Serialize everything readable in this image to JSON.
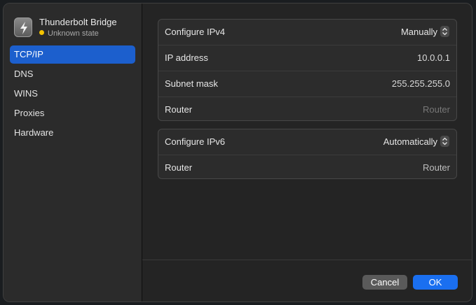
{
  "sidebar": {
    "title": "Thunderbolt Bridge",
    "status": "Unknown state",
    "items": [
      {
        "label": "TCP/IP",
        "active": true
      },
      {
        "label": "DNS"
      },
      {
        "label": "WINS"
      },
      {
        "label": "Proxies"
      },
      {
        "label": "Hardware"
      }
    ]
  },
  "ipv4": {
    "configure_label": "Configure IPv4",
    "configure_value": "Manually",
    "ip_label": "IP address",
    "ip_value": "10.0.0.1",
    "subnet_label": "Subnet mask",
    "subnet_value": "255.255.255.0",
    "router_label": "Router",
    "router_placeholder": "Router"
  },
  "ipv6": {
    "configure_label": "Configure IPv6",
    "configure_value": "Automatically",
    "router_label": "Router",
    "router_value": "Router"
  },
  "footer": {
    "cancel_label": "Cancel",
    "ok_label": "OK"
  },
  "colors": {
    "accent": "#1c5fcd",
    "ok_button": "#1a6ff0",
    "status_dot": "#f5c400"
  },
  "icons": {
    "app": "thunderbolt-icon",
    "stepper": "updown-chevron-icon"
  }
}
